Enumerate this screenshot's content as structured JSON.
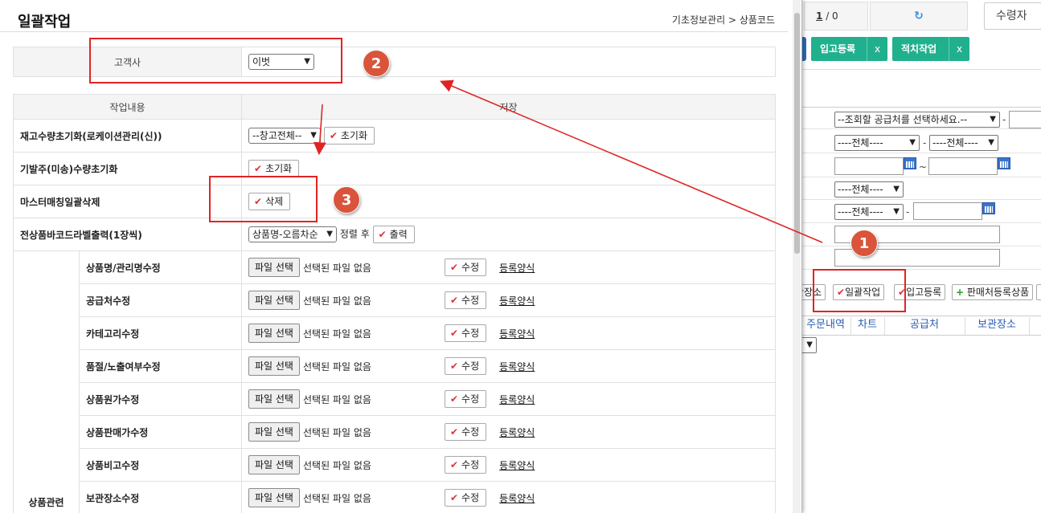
{
  "modal": {
    "title": "일괄작업",
    "breadcrumb": "기초정보관리 > 상품코드",
    "customer_label": "고객사",
    "customer_value": "이벗",
    "task_header": "작업내용",
    "save_header": "저장",
    "rows": {
      "stock_reset_label": "재고수량초기화(로케이션관리(신))",
      "stock_reset_select": "--창고전체--",
      "stock_reset_button": "초기화",
      "order_reset_label": "기발주(미송)수량초기화",
      "order_reset_button": "초기화",
      "master_delete_label": "마스터매칭일괄삭제",
      "master_delete_button": "삭제",
      "barcode_label": "전상품바코드라벨출력(1장씩)",
      "barcode_select": "상품명-오름차순",
      "barcode_sort_text": "정렬 후",
      "barcode_button": "출력"
    },
    "group_label": "상품관련",
    "file_button": "파일 선택",
    "file_none": "선택된 파일 없음",
    "edit_button": "수정",
    "form_link": "등록양식",
    "upload_rows": [
      {
        "label": "상품명/관리명수정"
      },
      {
        "label": "공급처수정"
      },
      {
        "label": "카테고리수정"
      },
      {
        "label": "품절/노출여부수정"
      },
      {
        "label": "상품원가수정"
      },
      {
        "label": "상품판매가수정"
      },
      {
        "label": "상품비고수정"
      },
      {
        "label": "보관장소수정"
      }
    ]
  },
  "background": {
    "pager_current": "1",
    "pager_total": "/ 0",
    "refresh_icon": "refresh-icon",
    "receiver_label": "수령자",
    "tabs": [
      {
        "label": "입고등록",
        "close": "x"
      },
      {
        "label": "적치작업",
        "close": "x"
      }
    ],
    "supplier_select": "--조회할 공급처를 선택하세요.--",
    "all_option": "----전체----",
    "tilde": "~",
    "dash": "-",
    "buttons": {
      "storage": "관장소",
      "bulk": "일괄작업",
      "inbound": "입고등록",
      "seller_product": "판매처등록상품"
    },
    "headers": [
      "주문내역",
      "차트",
      "공급처",
      "보관장소"
    ]
  },
  "annotations": {
    "badges": [
      "1",
      "2",
      "3"
    ],
    "accent": "#e02424",
    "badge_color": "#d9543a"
  }
}
